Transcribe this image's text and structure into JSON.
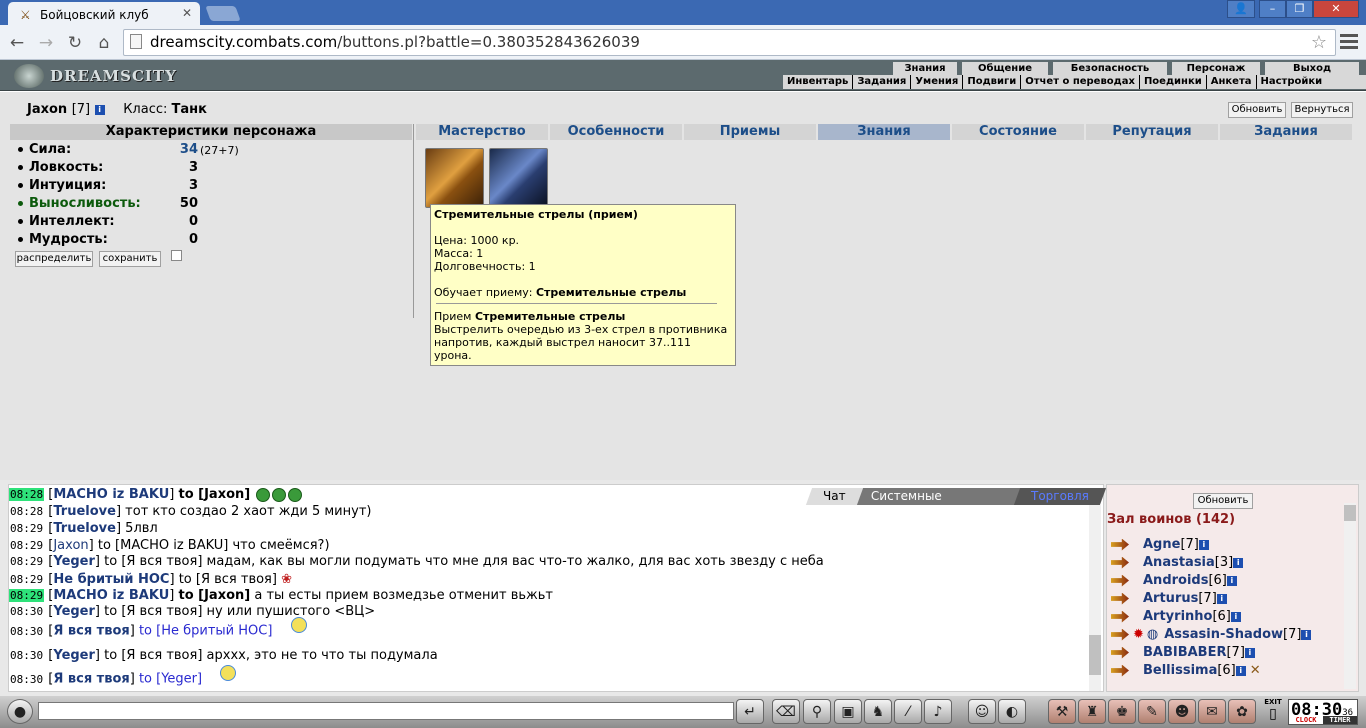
{
  "browser": {
    "tab_title": "Бойцовский клуб",
    "tab_close": "✕",
    "url_host": "dreamscity.combats.com",
    "url_path": "/buttons.pl?battle=0.380352843626039",
    "win_min": "–",
    "win_max": "❐",
    "win_close": "✕",
    "win_user": "👤"
  },
  "game": {
    "logo": "DREAMSCITY",
    "top_menu": [
      "Знания",
      "Общение",
      "Безопасность",
      "Персонаж",
      "Выход"
    ],
    "sub_menu": [
      "Инвентарь",
      "Задания",
      "Умения",
      "Подвиги",
      "Отчет о переводах",
      "Поединки",
      "Анкета",
      "Настройки"
    ]
  },
  "character": {
    "name": "Jaxon",
    "level": "[7]",
    "class_label": "Класс:",
    "class_value": "Танк",
    "refresh_btn": "Обновить",
    "back_btn": "Вернуться",
    "stats_title": "Характеристики персонажа",
    "stats": [
      {
        "label": "Сила:",
        "value": "34",
        "extra": "(27+7)"
      },
      {
        "label": "Ловкость:",
        "value": "3"
      },
      {
        "label": "Интуиция:",
        "value": "3"
      },
      {
        "label": "Выносливость:",
        "value": "50"
      },
      {
        "label": "Интеллект:",
        "value": "0"
      },
      {
        "label": "Мудрость:",
        "value": "0"
      }
    ],
    "distribute_btn": "распределить",
    "save_btn": "сохранить"
  },
  "tabs": [
    "Мастерство",
    "Особенности",
    "Приемы",
    "Знания",
    "Состояние",
    "Репутация",
    "Задания"
  ],
  "selected_tab": "Знания",
  "tooltip": {
    "title": "Стремительные стрелы (прием)",
    "price": "Цена: 1000 кр.",
    "mass": "Масса: 1",
    "durability": "Долговечность: 1",
    "teaches_label": "Обучает приему:",
    "teaches_value": "Стремительные стрелы",
    "skill_label": "Прием",
    "skill_name": "Стремительные стрелы",
    "description": "Выстрелить очередью из 3-ех стрел в противника напротив, каждый выстрел наносит 37..111 урона."
  },
  "chat": {
    "tabs": [
      "Чат",
      "Системные сообщения",
      "Торговля"
    ],
    "lines": [
      {
        "time": "08:28",
        "hl": true,
        "pre": "[",
        "nick": "MACHO iz BAKU",
        "post": "] ",
        "mid": "to [Jaxon]",
        "text": ""
      },
      {
        "time": "08:28",
        "hl": false,
        "pre": "[",
        "nick": "Truelove",
        "post": "] ",
        "mid": "",
        "text": "тот кто создао 2 хаот жди 5 минут)"
      },
      {
        "time": "08:29",
        "hl": false,
        "pre": "[",
        "nick": "Truelove",
        "post": "] ",
        "mid": "",
        "text": "5лвл"
      },
      {
        "time": "08:29",
        "hl": false,
        "pre": "[",
        "nick": "Jaxon",
        "post": "] ",
        "mid": "",
        "text": "to [MACHO iz BAKU] что смеёмся?)"
      },
      {
        "time": "08:29",
        "hl": false,
        "pre": "[",
        "nick": "Yeger",
        "post": "] ",
        "mid": "",
        "text": "to [Я вся твоя] мадам, как вы могли подумать что мне для вас что-то жалко, для вас хоть звезду с неба"
      },
      {
        "time": "08:29",
        "hl": false,
        "pre": "[",
        "nick": "Не бритый НОС",
        "post": "] ",
        "mid": "",
        "text": "to [Я вся твоя]"
      },
      {
        "time": "08:29",
        "hl": true,
        "pre": "[",
        "nick": "MACHO iz BAKU",
        "post": "] ",
        "mid": "to [Jaxon]",
        "text": " а ты есты прием возмедзье отменит вьжьт"
      },
      {
        "time": "08:30",
        "hl": false,
        "pre": "[",
        "nick": "Yeger",
        "post": "] ",
        "mid": "",
        "text": "to [Я вся твоя] ну или пушистого <ВЦ>"
      },
      {
        "time": "08:30",
        "hl": false,
        "pre": "[",
        "nick": "Я вся твоя",
        "post": "] ",
        "mid": "",
        "text": "to [Не бритый НОС]"
      },
      {
        "time": "08:30",
        "hl": false,
        "pre": "[",
        "nick": "Yeger",
        "post": "] ",
        "mid": "",
        "text": "to [Я вся твоя] архxx, это не то что ты подумала"
      },
      {
        "time": "08:30",
        "hl": false,
        "pre": "[",
        "nick": "Я вся твоя",
        "post": "] ",
        "mid": "",
        "text": "to [Yeger]"
      }
    ]
  },
  "userlist": {
    "refresh_btn": "Обновить",
    "hall_title": "Зал воинов (142)",
    "users": [
      {
        "name": "Agne",
        "level": "[7]"
      },
      {
        "name": "Anastasia",
        "level": "[3]"
      },
      {
        "name": "Androids",
        "level": "[6]"
      },
      {
        "name": "Arturus",
        "level": "[7]"
      },
      {
        "name": "Artyrinho",
        "level": "[6]"
      },
      {
        "name": "Assasin-Shadow",
        "level": "[7]"
      },
      {
        "name": "BABIBABER",
        "level": "[7]"
      },
      {
        "name": "Bellissima",
        "level": "[6]"
      }
    ]
  },
  "clock": {
    "time": "08:30",
    "sec": "36",
    "clock_label": "CLOCK",
    "timer_label": "TIMER",
    "exit_label": "EXIT"
  }
}
